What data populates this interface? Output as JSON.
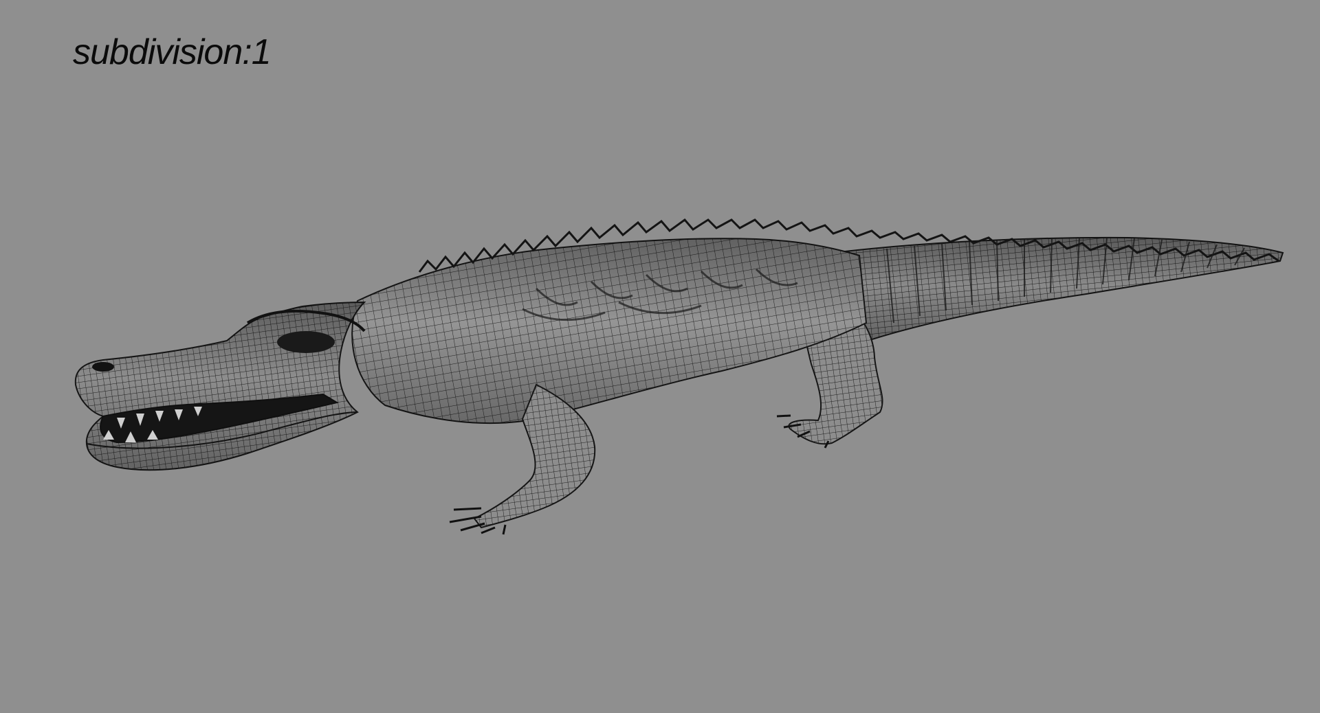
{
  "overlay": {
    "label": "subdivision:1"
  },
  "model": {
    "subject": "alligator",
    "render_mode": "wireframe-on-shaded",
    "background_color": "#8f8f8f",
    "skin_color": "#909090",
    "wire_color": "#1b1b1b",
    "dark_color": "#161616"
  }
}
